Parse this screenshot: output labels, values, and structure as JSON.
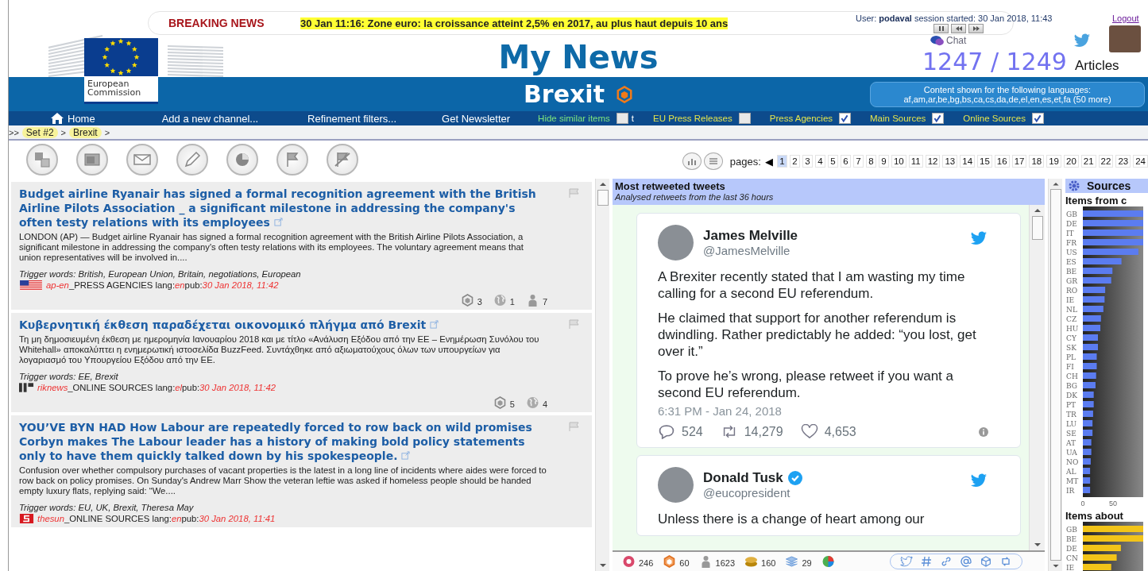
{
  "header": {
    "logo_text": "European Commission",
    "breaking_label": "BREAKING NEWS",
    "breaking_text": "30 Jan 11:16:  Zone euro: la croissance atteint 2,5% en 2017, au plus haut depuis 10 ans",
    "user_label": "User:",
    "user_name": "podaval",
    "session": "session started: 30 Jan 2018, 11:43",
    "logout": "Logout",
    "chat": "Chat",
    "app_title": "My News",
    "article_count": "1247 / 1249",
    "articles_label": "Articles"
  },
  "channel": {
    "title": "Brexit",
    "languages_label": "Content shown for the following languages:",
    "languages": "af,am,ar,be,bg,bs,ca,cs,da,de,el,en,es,et,fa (50 more)"
  },
  "nav": [
    {
      "label": "Home",
      "kind": "home"
    },
    {
      "label": "Add a new channel...",
      "kind": "link"
    },
    {
      "label": "Refinement filters...",
      "kind": "link"
    },
    {
      "label": "Get Newsletter",
      "kind": "link"
    }
  ],
  "filters": [
    {
      "label": "Hide similar items",
      "checked": false,
      "kind": "option",
      "suffix": "t"
    },
    {
      "label": "EU Press Releases",
      "checked": false,
      "kind": "source"
    },
    {
      "label": "Press Agencies",
      "checked": true,
      "kind": "source"
    },
    {
      "label": "Main Sources",
      "checked": true,
      "kind": "source"
    },
    {
      "label": "Online Sources",
      "checked": true,
      "kind": "source"
    }
  ],
  "breadcrumb": {
    "start": ">>",
    "separator": ">",
    "items": [
      "Set #2",
      "Brexit"
    ]
  },
  "pagination": {
    "label": "pages:",
    "prev": "◀",
    "pages": [
      {
        "label": "1",
        "selected": true
      },
      {
        "label": "2",
        "selected": false
      },
      {
        "label": "3",
        "selected": false
      },
      {
        "label": "4",
        "selected": false
      },
      {
        "label": "5",
        "selected": false
      },
      {
        "label": "6",
        "selected": false
      },
      {
        "label": "7",
        "selected": false
      },
      {
        "label": "8",
        "selected": false
      },
      {
        "label": "9",
        "selected": false
      },
      {
        "label": "10",
        "selected": false
      },
      {
        "label": "11",
        "selected": false
      },
      {
        "label": "12",
        "selected": false
      },
      {
        "label": "13",
        "selected": false
      },
      {
        "label": "14",
        "selected": false
      },
      {
        "label": "15",
        "selected": false
      },
      {
        "label": "16",
        "selected": false
      },
      {
        "label": "17",
        "selected": false
      },
      {
        "label": "18",
        "selected": false
      },
      {
        "label": "19",
        "selected": false
      },
      {
        "label": "20",
        "selected": false
      },
      {
        "label": "21",
        "selected": false
      },
      {
        "label": "22",
        "selected": false
      },
      {
        "label": "23",
        "selected": false
      },
      {
        "label": "24",
        "selected": false
      }
    ]
  },
  "articles": [
    {
      "title": "Budget airline Ryanair has signed a formal recognition agreement with the British Airline Pilots Association _ a significant milestone in addressing the company's often testy relations with its employees",
      "summary": "LONDON (AP) — Budget airline Ryanair has signed a formal recognition agreement with the British Airline Pilots Association, a significant milestone in addressing the company's often testy relations with its employees. The voluntary agreement means that union representatives will be involved in....",
      "triggers": "Trigger words: British, European Union, Britain, negotiations, European",
      "source_logo": {
        "kind": "flag"
      },
      "source_line": [
        {
          "text": "ap-en",
          "kind": "highlight"
        },
        {
          "text": "_PRESS AGENCIES lang:",
          "kind": "plain"
        },
        {
          "text": "en",
          "kind": "highlight"
        },
        {
          "text": "pub:",
          "kind": "plain"
        },
        {
          "text": "30 Jan 2018, 11:42",
          "kind": "highlight"
        }
      ],
      "stats": [
        {
          "kind": "cluster",
          "count": "3"
        },
        {
          "kind": "globe",
          "count": "1"
        },
        {
          "kind": "people",
          "count": "7"
        }
      ]
    },
    {
      "title": "Κυβερνητική έκθεση παραδέχεται οικονομικό πλήγμα από Brexit",
      "summary": "Τη μη δημοσιευμένη έκθεση με ημερομηνία Ιανουαρίου 2018 και με τίτλο «Ανάλυση Εξόδου από την ΕΕ – Ενημέρωση Συνόλου του Whitehall» αποκαλύπτει η ενημερωτική ιστοσελίδα BuzzFeed. Συντάχθηκε από αξιωματούχους όλων των υπουργείων για λογαριασμό του Υπουργείου Εξόδου από την ΕΕ.",
      "triggers": "Trigger words: EE, Brexit",
      "source_logo": {
        "kind": "logo_dark"
      },
      "source_line": [
        {
          "text": "riknews",
          "kind": "highlight"
        },
        {
          "text": "_ONLINE SOURCES lang:",
          "kind": "plain"
        },
        {
          "text": "el",
          "kind": "highlight"
        },
        {
          "text": "pub:",
          "kind": "plain"
        },
        {
          "text": "30 Jan 2018, 11:42",
          "kind": "highlight"
        }
      ],
      "stats": [
        {
          "kind": "cluster",
          "count": "5"
        },
        {
          "kind": "globe",
          "count": "4"
        }
      ]
    },
    {
      "title": "YOU’VE BYN HAD How Labour are repeatedly forced to row back on wild promises Corbyn makes The Labour leader has a history of making bold policy statements only to have them quickly talked down by his spokespeople.",
      "summary": "Confusion over whether compulsory purchases of vacant properties is the latest in a long line of incidents where aides were forced to row back on policy promises. On Sunday's Andrew Marr Show the veteran leftie was asked if homeless people should be handed empty luxury flats, replying said: “We....",
      "triggers": "Trigger words: EU, UK, Brexit, Theresa May",
      "source_logo": {
        "kind": "logo_red"
      },
      "source_line": [
        {
          "text": "thesun",
          "kind": "highlight"
        },
        {
          "text": "_ONLINE SOURCES lang:",
          "kind": "plain"
        },
        {
          "text": "en",
          "kind": "highlight"
        },
        {
          "text": "pub:",
          "kind": "plain"
        },
        {
          "text": "30 Jan 2018, 11:41",
          "kind": "highlight"
        }
      ]
    }
  ],
  "tweets": {
    "title": "Most retweeted tweets",
    "subtitle": "Analysed retweets from the last 36 hours",
    "items": [
      {
        "name": "James Melville",
        "handle": "@JamesMelville",
        "verified": false,
        "paragraphs": [
          "A Brexiter recently stated that I am wasting my time calling for a second EU referendum.",
          "He claimed that support for another referendum is dwindling. Rather predictably he added: “you lost, get over it.”",
          "To prove he’s wrong, please retweet if you want a second EU referendum."
        ],
        "time": "6:31 PM - Jan 24, 2018",
        "replies": "524",
        "retweets": "14,279",
        "likes": "4,653"
      },
      {
        "name": "Donald Tusk",
        "handle": "@eucopresident",
        "verified": true,
        "paragraphs": [
          "Unless there is a change of heart among our"
        ]
      }
    ],
    "stats": [
      {
        "kind": "shares",
        "count": "246"
      },
      {
        "kind": "clusters",
        "count": "60"
      },
      {
        "kind": "people",
        "count": "1623"
      },
      {
        "kind": "coins",
        "count": "160"
      },
      {
        "kind": "layers",
        "count": "29"
      },
      {
        "kind": "chart"
      }
    ],
    "tools": [
      {
        "kind": "twitter"
      },
      {
        "kind": "hashtag"
      },
      {
        "kind": "link"
      },
      {
        "kind": "mention"
      },
      {
        "kind": "cluster"
      },
      {
        "kind": "retweet"
      }
    ]
  },
  "sources": {
    "title": "Sources",
    "charts": [
      {
        "title": "Items from c",
        "chart_data": {
          "type": "bar",
          "orientation": "horizontal",
          "categories": [
            "GB",
            "DE",
            "IT",
            "FR",
            "US",
            "ES",
            "BE",
            "GR",
            "RO",
            "IE",
            "NL",
            "CZ",
            "HU",
            "CY",
            "SK",
            "PL",
            "FI",
            "CH",
            "BG",
            "DK",
            "PT",
            "TR",
            "LU",
            "SE",
            "AT",
            "UA",
            "NO",
            "AL",
            "MT",
            "IR"
          ],
          "values": [
            100,
            100,
            100,
            100,
            92,
            64,
            49,
            47,
            37,
            36,
            34,
            30,
            29,
            25,
            25,
            23,
            23,
            22,
            21,
            18,
            18,
            17,
            16,
            16,
            14,
            14,
            13,
            12,
            12,
            12
          ],
          "xlim": [
            0,
            100
          ],
          "xticks": [
            0,
            50
          ]
        }
      },
      {
        "title": "Items about",
        "chart_data": {
          "type": "bar",
          "orientation": "horizontal",
          "categories": [
            "GB",
            "BE",
            "DE",
            "CN",
            "IE"
          ],
          "values": [
            100,
            100,
            63,
            56,
            47
          ],
          "xlim": [
            0,
            100
          ]
        }
      }
    ]
  }
}
